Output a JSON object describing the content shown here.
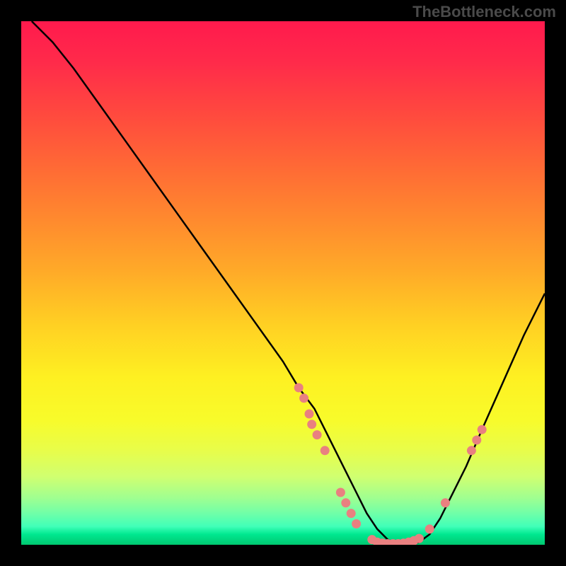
{
  "watermark": "TheBottleneck.com",
  "chart_data": {
    "type": "line",
    "title": "",
    "xlabel": "",
    "ylabel": "",
    "xlim": [
      0,
      100
    ],
    "ylim": [
      0,
      100
    ],
    "series": [
      {
        "name": "curve",
        "x": [
          2,
          6,
          10,
          15,
          20,
          25,
          30,
          35,
          40,
          45,
          50,
          53,
          56,
          58,
          60,
          62,
          64,
          66,
          68,
          70,
          72,
          74,
          76,
          78,
          80,
          82,
          85,
          88,
          92,
          96,
          100
        ],
        "y": [
          100,
          96,
          91,
          84,
          77,
          70,
          63,
          56,
          49,
          42,
          35,
          30,
          26,
          22,
          18,
          14,
          10,
          6,
          3,
          1,
          0,
          0,
          0.5,
          2,
          5,
          9,
          15,
          22,
          31,
          40,
          48
        ]
      }
    ],
    "points": [
      {
        "x": 53,
        "y": 30
      },
      {
        "x": 54,
        "y": 28
      },
      {
        "x": 55,
        "y": 25
      },
      {
        "x": 55.5,
        "y": 23
      },
      {
        "x": 56.5,
        "y": 21
      },
      {
        "x": 58,
        "y": 18
      },
      {
        "x": 61,
        "y": 10
      },
      {
        "x": 62,
        "y": 8
      },
      {
        "x": 63,
        "y": 6
      },
      {
        "x": 64,
        "y": 4
      },
      {
        "x": 67,
        "y": 1
      },
      {
        "x": 68,
        "y": 0.5
      },
      {
        "x": 69,
        "y": 0.3
      },
      {
        "x": 70,
        "y": 0.2
      },
      {
        "x": 71,
        "y": 0.2
      },
      {
        "x": 72,
        "y": 0.2
      },
      {
        "x": 73,
        "y": 0.3
      },
      {
        "x": 74,
        "y": 0.5
      },
      {
        "x": 75,
        "y": 0.8
      },
      {
        "x": 76,
        "y": 1.2
      },
      {
        "x": 78,
        "y": 3
      },
      {
        "x": 81,
        "y": 8
      },
      {
        "x": 86,
        "y": 18
      },
      {
        "x": 87,
        "y": 20
      },
      {
        "x": 88,
        "y": 22
      }
    ],
    "point_color": "#e98080",
    "curve_color": "#000000",
    "background": "gradient-red-yellow-green"
  }
}
